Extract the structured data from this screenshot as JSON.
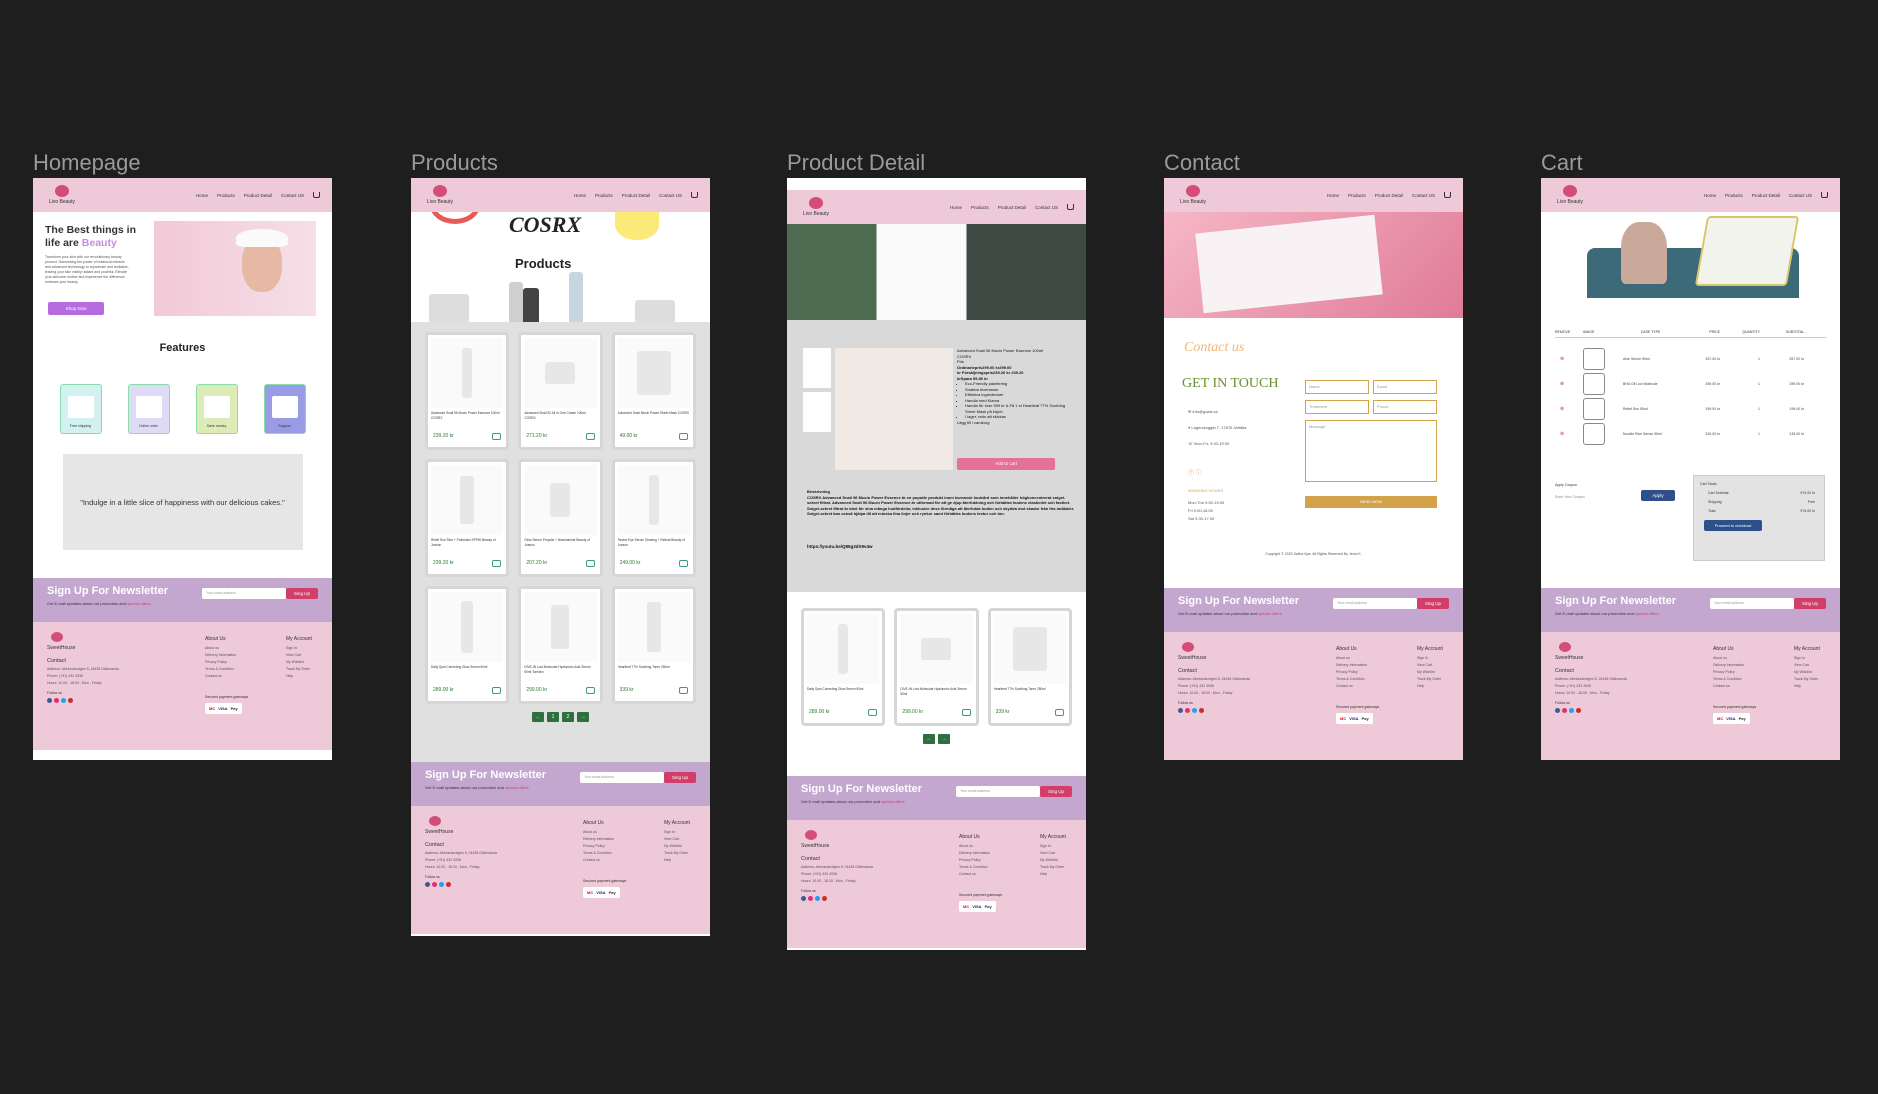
{
  "frames": {
    "homepage": "Homepage",
    "products": "Products",
    "detail": "Product Detail",
    "contact": "Contact",
    "cart": "Cart"
  },
  "nav": {
    "logo_text": "Livo Beauty",
    "links": [
      "Home",
      "Products",
      "Product Detail",
      "Contact US"
    ]
  },
  "home": {
    "hero_title": "The Best things in life are",
    "hero_highlight": "Beauty",
    "hero_text": "Transform your skin with our revolutionary beauty product. Harnessing the power of botanical extracts and advanced technology to rejuvenate and revitalize, leaving your skin visibly radiant and youthful. Elevate your skincare routine and experience the difference, embrace your beauty.",
    "shop_button": "Shop Now",
    "features_title": "Features",
    "features": [
      "Free shipping",
      "Online order",
      "Save money",
      "Support"
    ],
    "quote": "\"Indulge in a little slice of happiness with our delicious cakes.\""
  },
  "products": {
    "banner_brand": "COSRX",
    "banner_title": "Products",
    "items": [
      {
        "name": "Advanced Snail 96 Mucin Power Essence 100ml COSRX",
        "price": "239.20 kr"
      },
      {
        "name": "Advanced Snail 92 All In One Cream 100ml COSRX",
        "price": "271.20 kr"
      },
      {
        "name": "Advanced Snail Mucin Power Sheet Mask COSRX",
        "price": "49.00 kr"
      },
      {
        "name": "Relief Sun Rice + Probiotics SPF50 Beauty of Joseon",
        "price": "239.20 kr"
      },
      {
        "name": "Glow Serum Propolis + Niacinamide Beauty of Joseon",
        "price": "207.20 kr"
      },
      {
        "name": "Revive Eye Serum Ginseng + Retinal Beauty of Joseon",
        "price": "249.00 kr"
      },
      {
        "name": "Daily Spot Correcting Glow Serum 50ml",
        "price": "289.00 kr"
      },
      {
        "name": "DIVE-IN Low Molecular Hyaluronic Acid Serum 50ml Torriden",
        "price": "299.00 kr"
      },
      {
        "name": "Heartleaf 77% Soothing Toner 250ml",
        "price": "339 kr"
      }
    ],
    "pager": [
      "←",
      "1",
      "2",
      "→"
    ]
  },
  "detail": {
    "name": "Advanced Snail 96 Mucin Power Essence 100ml",
    "brand": "COSRX",
    "price_label": "Pris",
    "ordinary": "Ordinariepris299.00 kr299.00",
    "sale": "kr Försäljningspris239.20 kr 239.20",
    "save": "krSpara 59.80 kr",
    "bullets": [
      "Eco-Friendly paketering",
      "Snabba leveranser",
      "Effektiva ingredienser",
      "Handla med Klarna",
      "Handla för över 599 kr & Få 1 st Heartleaf 77% Soothing Sheet Mask på köpet",
      "I lager, redo att skickas"
    ],
    "stock": "Lägg till i varukorg",
    "add_button": "Add to cart",
    "desc_label": "Beskrivning",
    "description": "COSRX Advanced Snail 96 Mucin Power Essence är en populär produkt inom koreansk hudvård som innehåller högkoncentrerat snigel-sekret filtrat. Advanced Snail 96 Mucin Power Essence är utformad för att ge djup återfuktning och förbättra hudens elasticitet och fasthet. Snigel-sekret filtrat är känt för sina många hudfördelar, inklusive dess förmåga att återfukta huden och skydda mot skador från fria radikaler. Snigel-sekret kan också hjälpa till att minska fina linjer och rynkor samt förbättra hudens textur och ton.",
    "video_link": "https://youtu.be/Q85g3dX9v4w",
    "related": [
      {
        "name": "Daily Spot Correcting Glow Serum 50ml",
        "price": "289.00 kr"
      },
      {
        "name": "DIVE-IN Low Molecular Hyaluronic Acid Serum 50ml",
        "price": "299.00 kr"
      },
      {
        "name": "Heartleaf 77% Soothing Toner 250ml",
        "price": "339 kr"
      }
    ],
    "pager": [
      "←",
      "→"
    ]
  },
  "contact": {
    "script_title": "Contact us",
    "title": "GET IN TOUCH",
    "email": "info@goals.se",
    "address": "Lagerskoggat 7, 17676 Järfälla",
    "hours_short": "Mon-Fri, 9.00-19.00",
    "hours_title": "WORKING HOURS",
    "hours": [
      "Mon-Thu 9.00-19.00",
      "Fri 9.00-18.00",
      "Sat 9.00-17.00"
    ],
    "fields": {
      "name": "Name",
      "epost": "Epost",
      "treatment": "Treatment",
      "phone": "Phone",
      "message": "Message"
    },
    "send": "SEND NOW",
    "copyright": "Copyright © 2023 Salina Spa. All Rights Reserved By Jenni K."
  },
  "cart": {
    "headers": [
      "REMOVE",
      "IMAGE",
      "CASE TYPE",
      "PRICE",
      "QUANTITY",
      "SUBTOTAL"
    ],
    "rows": [
      {
        "name": "Aloe Serum 50ml",
        "price": "267.00 kr",
        "qty": "1",
        "sub": "267.00 kr"
      },
      {
        "name": "BHA Oil Low Molecule",
        "price": "259.00 kr",
        "qty": "1",
        "sub": "259.00 kr"
      },
      {
        "name": "Relief Sun 50ml",
        "price": "199.00 kr",
        "qty": "1",
        "sub": "199.00 kr"
      },
      {
        "name": "Noodle Rice Serum 50ml",
        "price": "249.00 kr",
        "qty": "1",
        "sub": "249.00 kr"
      }
    ],
    "coupon_title": "Apply Coupon",
    "coupon_placeholder": "Enter Your Coupon",
    "apply": "Apply",
    "totals_title": "Cart Totals",
    "subtotal_label": "Cart Subtotal",
    "subtotal": "974.00 kr",
    "shipping_label": "Shipping",
    "shipping": "Free",
    "total_label": "Total",
    "total": "974.00 kr",
    "checkout": "Proceed to checkout"
  },
  "newsletter": {
    "title": "Sign Up For Newsletter",
    "text": "Get E-mail updates about our promotion and",
    "highlight": "special offers.",
    "placeholder": "Your email address",
    "button": "Sing Up"
  },
  "footer": {
    "brand": "SweetHouse",
    "contact": "Contact",
    "address": "Address:  Abelundsvägen 5, 24435 Gällovanda",
    "phone": "Phone:   (+91) 432 4936",
    "hours": "Hours:   10.00 - 18.00 , Mon - Friday",
    "follow": "Follow us",
    "about_title": "About Us",
    "about": [
      "About us",
      "Delivery Information",
      "Privacy Policy",
      "Terms & Condition",
      "Contact us"
    ],
    "account_title": "My Account",
    "account": [
      "Sign In",
      "View Cart",
      "My Wishlist",
      "Track My Order",
      "Help"
    ],
    "payment_label": "Secured payment gateways",
    "payments": [
      "MC",
      "VISA",
      "Pay"
    ]
  },
  "colors": {
    "nav_pink": "#eec9d8",
    "newsletter_purple": "#c3a7cf",
    "accent_red": "#d23d6a",
    "cta_purple": "#b76be0"
  }
}
